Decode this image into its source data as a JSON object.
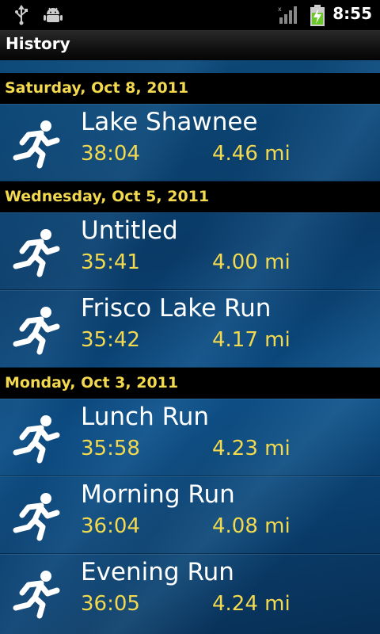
{
  "status_bar": {
    "time": "8:55",
    "icons": [
      "usb-icon",
      "android-debug-icon",
      "signal-icon",
      "battery-charging-icon"
    ]
  },
  "title_bar": {
    "title": "History"
  },
  "colors": {
    "accent": "#f2d94e",
    "header_bg": "#000000",
    "list_bg": "#0b4a80"
  },
  "sections": [
    {
      "date": "Saturday, Oct 8, 2011",
      "runs": [
        {
          "name": "Lake Shawnee",
          "time": "38:04",
          "distance": "4.46 mi"
        }
      ]
    },
    {
      "date": "Wednesday, Oct 5, 2011",
      "runs": [
        {
          "name": "Untitled",
          "time": "35:41",
          "distance": "4.00 mi"
        },
        {
          "name": "Frisco Lake Run",
          "time": "35:42",
          "distance": "4.17 mi"
        }
      ]
    },
    {
      "date": "Monday, Oct 3, 2011",
      "runs": [
        {
          "name": "Lunch Run",
          "time": "35:58",
          "distance": "4.23 mi"
        },
        {
          "name": "Morning Run",
          "time": "36:04",
          "distance": "4.08 mi"
        },
        {
          "name": "Evening Run",
          "time": "36:05",
          "distance": "4.24 mi"
        }
      ]
    }
  ]
}
